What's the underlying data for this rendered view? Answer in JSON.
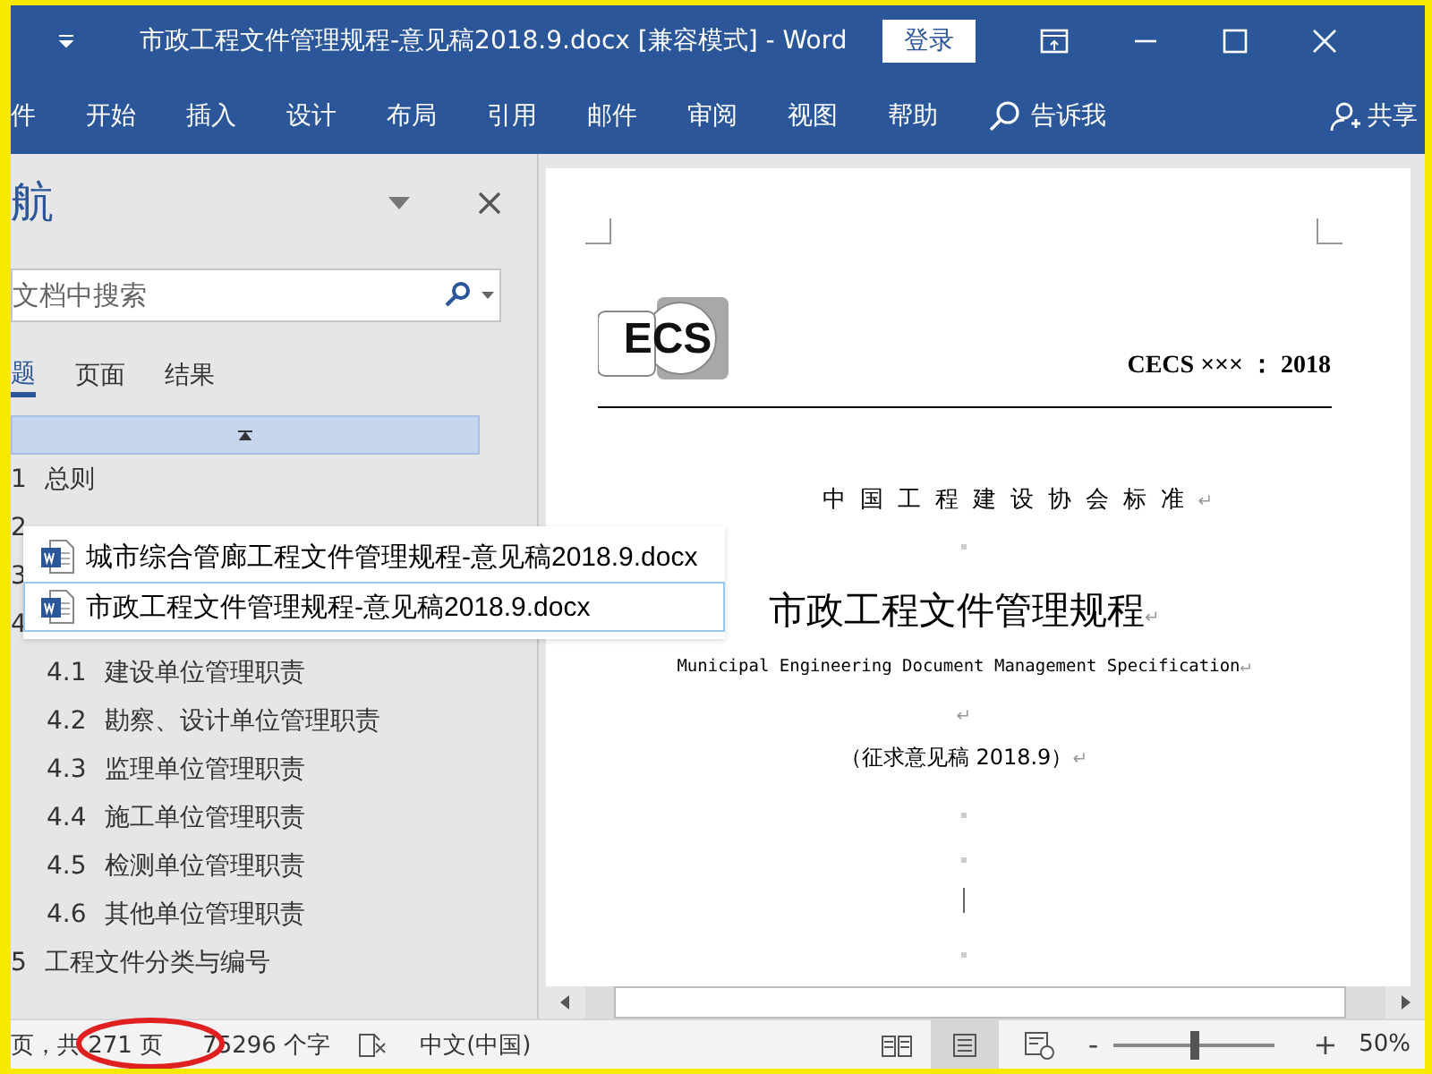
{
  "window": {
    "title": "市政工程文件管理规程-意见稿2018.9.docx [兼容模式]  -  Word",
    "sign_in": "登录"
  },
  "ribbon_tabs": [
    {
      "label": "件",
      "selected": false
    },
    {
      "label": "开始",
      "selected": false
    },
    {
      "label": "插入",
      "selected": false
    },
    {
      "label": "设计",
      "selected": false
    },
    {
      "label": "布局",
      "selected": false
    },
    {
      "label": "引用",
      "selected": false
    },
    {
      "label": "邮件",
      "selected": false
    },
    {
      "label": "审阅",
      "selected": false
    },
    {
      "label": "视图",
      "selected": false
    },
    {
      "label": "帮助",
      "selected": false
    }
  ],
  "tell_me": "告诉我",
  "share": "共享",
  "nav": {
    "title": "航",
    "search": {
      "placeholder": "文档中搜索"
    },
    "tabs": [
      {
        "label": "题",
        "selected": true
      },
      {
        "label": "页面",
        "selected": false
      },
      {
        "label": "结果",
        "selected": false
      }
    ],
    "headings": [
      {
        "number": "1",
        "title": "总则"
      },
      {
        "number": "2"
      },
      {
        "number": "3"
      },
      {
        "number": "4",
        "children": [
          {
            "number": "4.1",
            "title": "建设单位管理职责"
          },
          {
            "number": "4.2",
            "title": "勘察、设计单位管理职责"
          },
          {
            "number": "4.3",
            "title": "监理单位管理职责"
          },
          {
            "number": "4.4",
            "title": "施工单位管理职责"
          },
          {
            "number": "4.5",
            "title": "检测单位管理职责"
          },
          {
            "number": "4.6",
            "title": "其他单位管理职责"
          }
        ]
      },
      {
        "number": "5",
        "title": "工程文件分类与编号"
      }
    ]
  },
  "recent_files": [
    {
      "name": "城市综合管廊工程文件管理规程-意见稿2018.9.docx",
      "selected": false
    },
    {
      "name": "市政工程文件管理规程-意见稿2018.9.docx",
      "selected": true
    }
  ],
  "document": {
    "logo_text": "ECS",
    "code": "CECS  ×××  ：  2018",
    "standard": {
      "text": "中国工程建设协会标准",
      "mark": "↵"
    },
    "title": {
      "text": "市政工程文件管理规程",
      "mark": "↵"
    },
    "english": {
      "text": "Municipal Engineering Document Management Specification",
      "mark": "↵"
    },
    "blank_mark": "↵",
    "draft": {
      "text": "（征求意见稿 2018.9）",
      "mark": "↵"
    }
  },
  "status_bar": {
    "pages": "页，共 271 页",
    "words": "75296 个字",
    "language": "中文(中国)",
    "zoom_minus": "-",
    "zoom_plus": "+",
    "zoom": "50%",
    "zoom_slider": {
      "level": 0.5
    }
  }
}
